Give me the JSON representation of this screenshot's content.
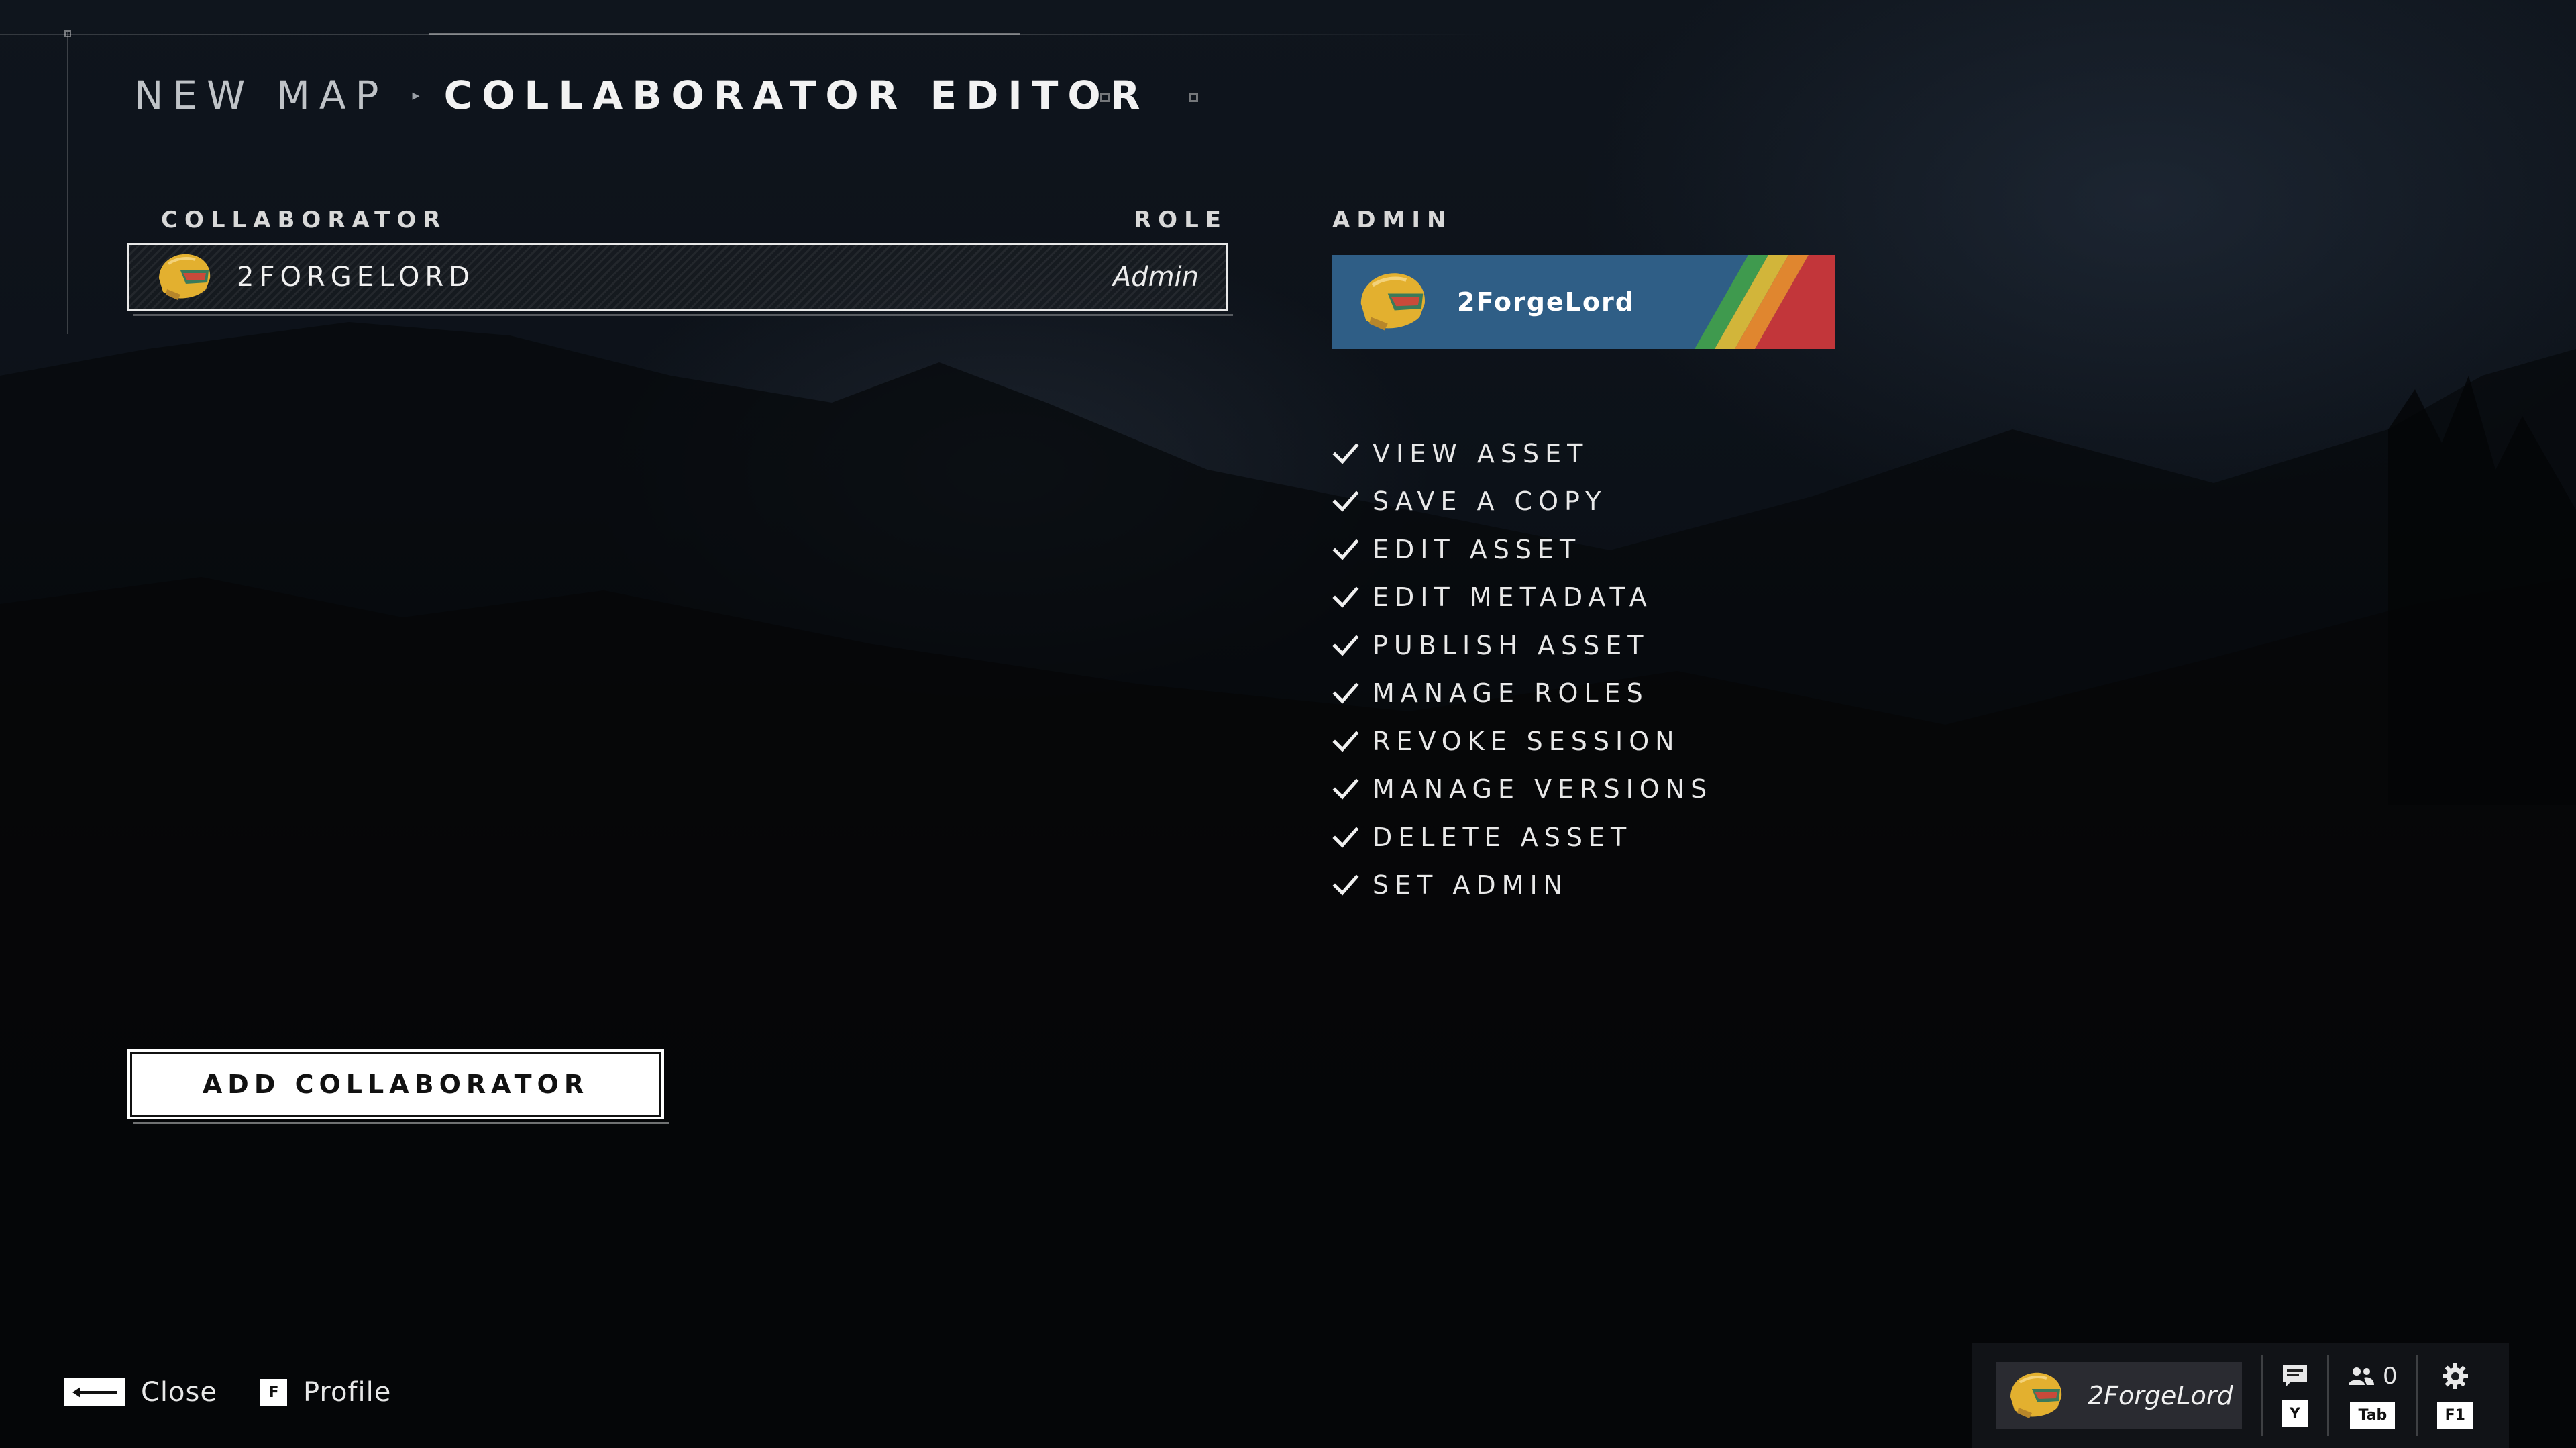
{
  "breadcrumb": {
    "parent": "NEW MAP",
    "separator": "▸",
    "current": "COLLABORATOR EDITOR"
  },
  "collaborators_table": {
    "column_collaborator": "COLLABORATOR",
    "column_role": "ROLE",
    "rows": [
      {
        "name": "2FORGELORD",
        "role": "Admin",
        "avatar": "helmet-icon"
      }
    ]
  },
  "role_panel": {
    "heading": "ADMIN",
    "card_name": "2ForgeLord",
    "card_colors": {
      "background": "#2f5e86",
      "stripes": [
        "#3f9a4e",
        "#d2b53a",
        "#e0862f",
        "#c2363a"
      ]
    },
    "permissions": [
      "VIEW ASSET",
      "SAVE A COPY",
      "EDIT ASSET",
      "EDIT METADATA",
      "PUBLISH ASSET",
      "MANAGE ROLES",
      "REVOKE SESSION",
      "MANAGE VERSIONS",
      "DELETE ASSET",
      "SET ADMIN"
    ]
  },
  "actions": {
    "add_collaborator": "ADD COLLABORATOR"
  },
  "footer": {
    "close_label": "Close",
    "profile_key": "F",
    "profile_label": "Profile"
  },
  "hud": {
    "player_name": "2ForgeLord",
    "chat_key": "Y",
    "friends_count": "0",
    "friends_key": "Tab",
    "settings_key": "F1"
  }
}
